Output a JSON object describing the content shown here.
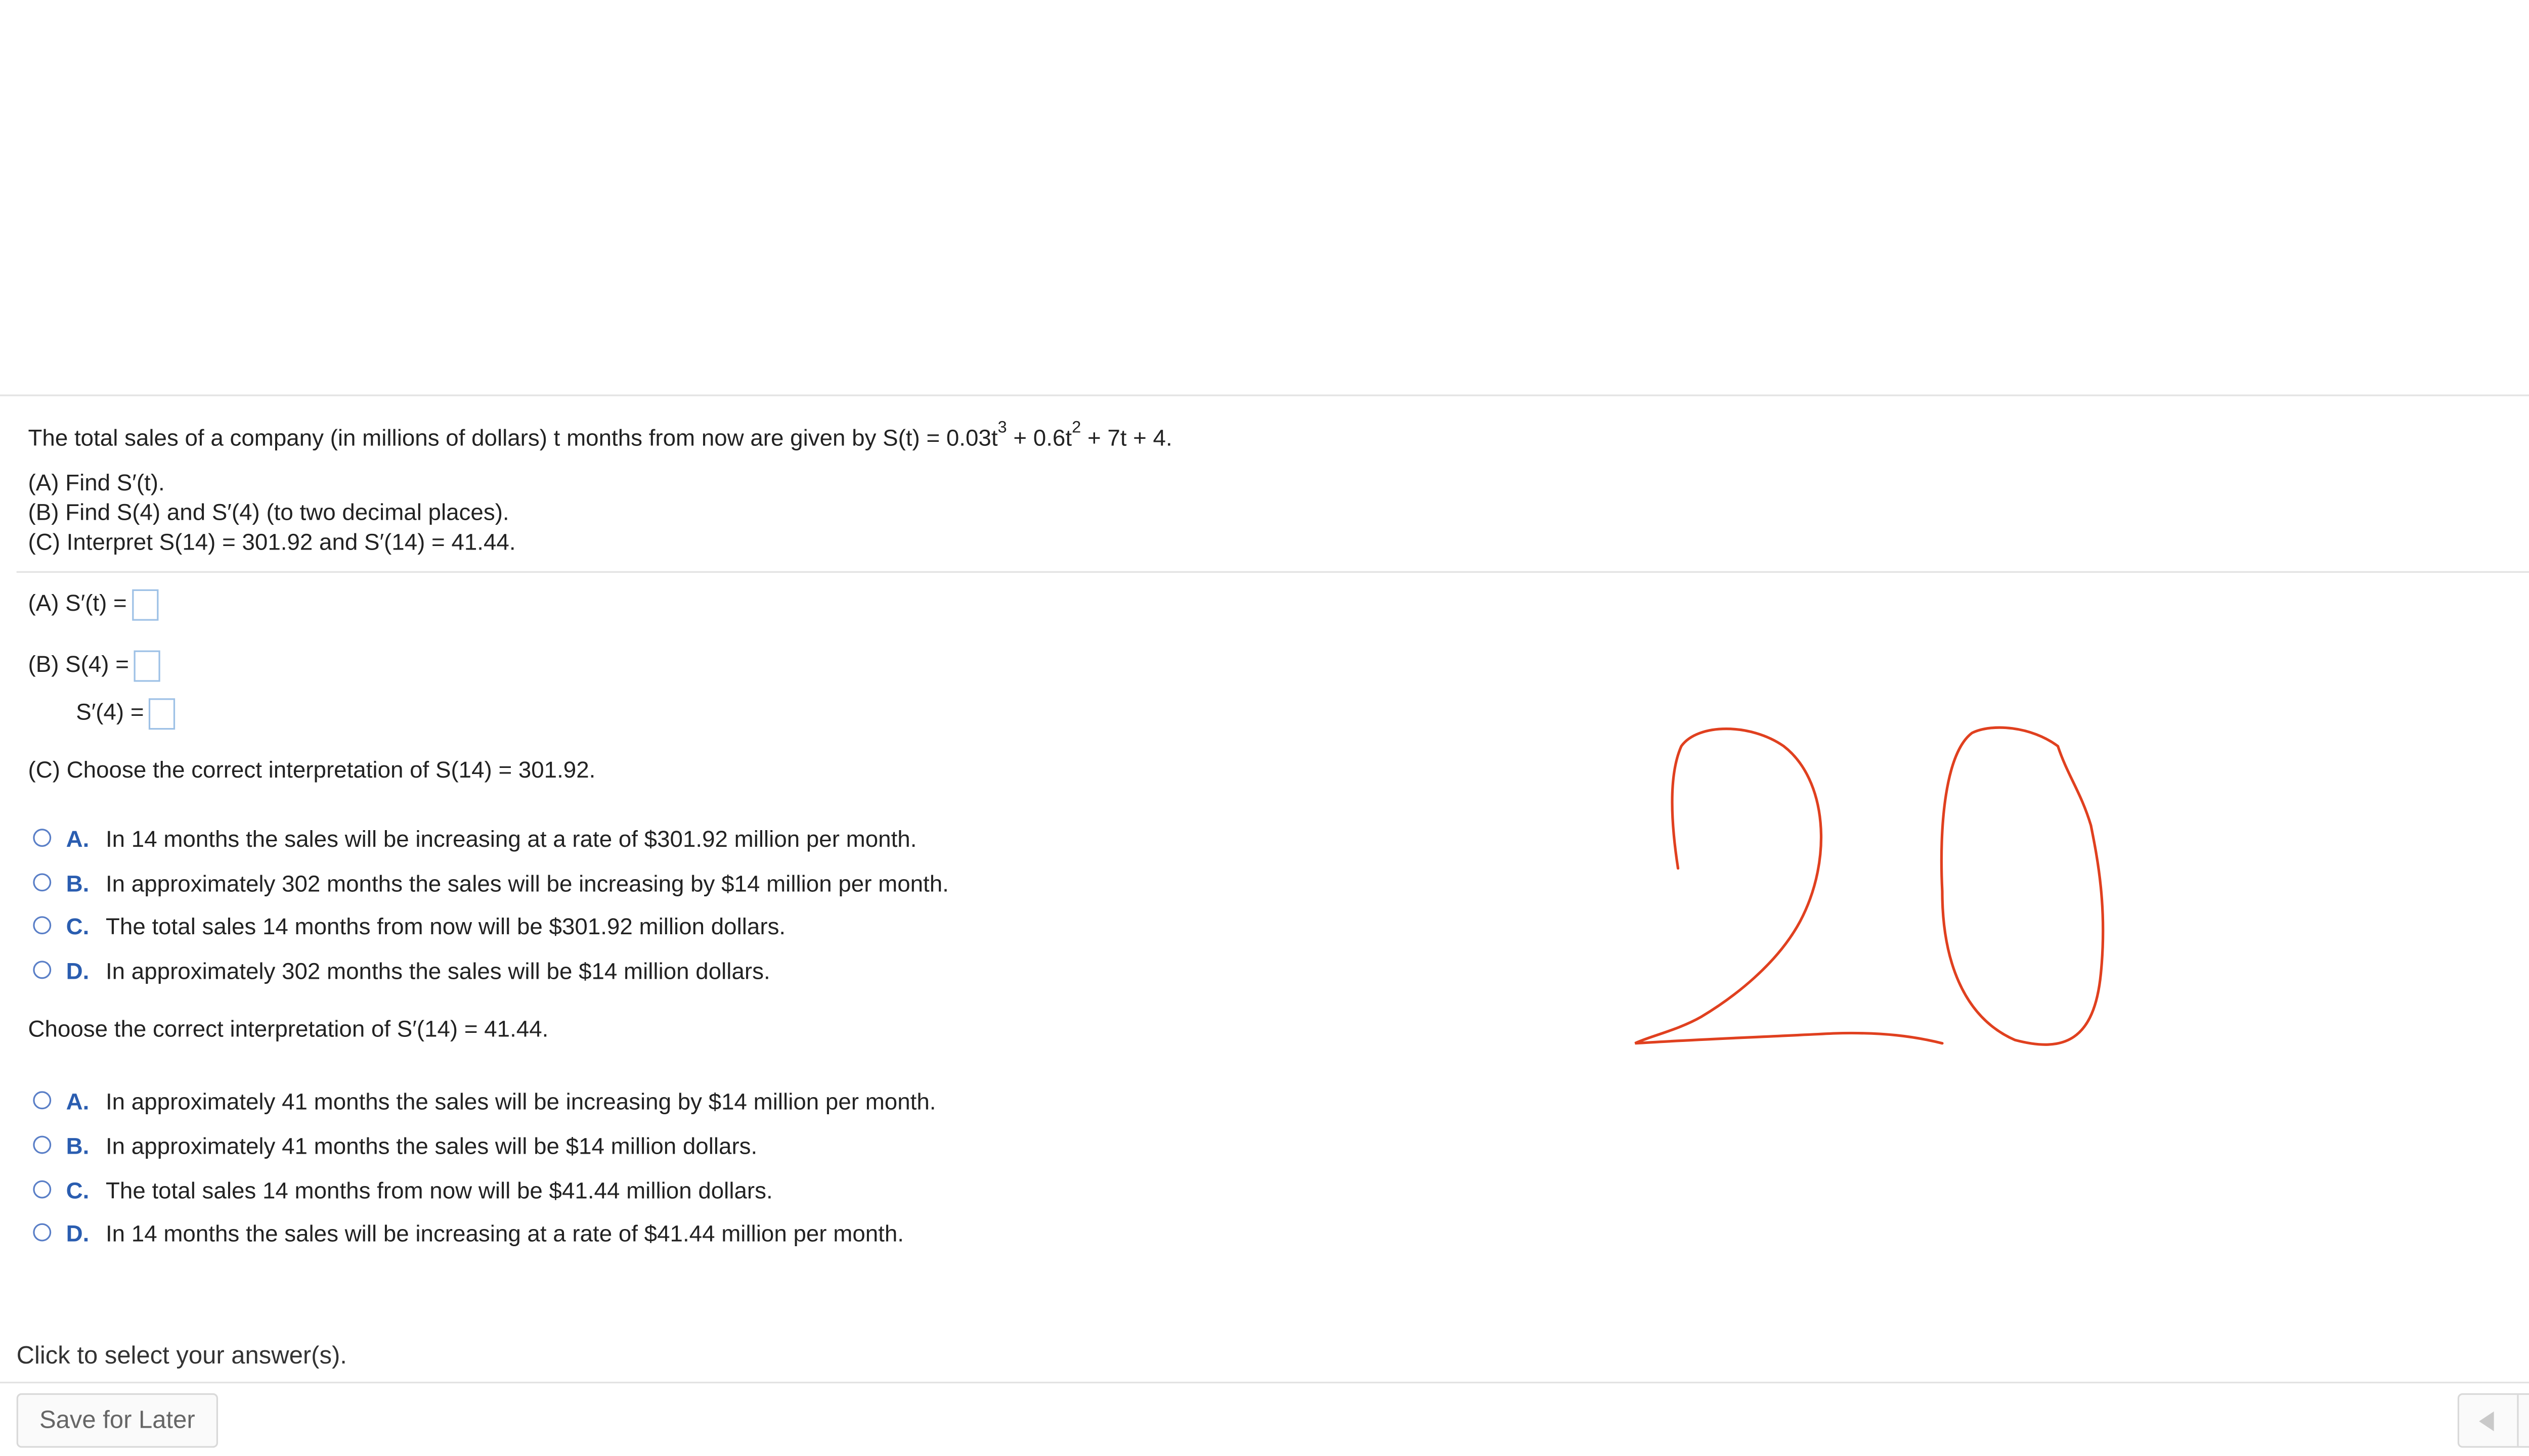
{
  "question": {
    "stem_prefix": "The total sales of a company (in millions of dollars) t months from now are given by S(t) = 0.03t",
    "stem_exp1": "3",
    "stem_mid": " + 0.6t",
    "stem_exp2": "2",
    "stem_suffix": " + 7t + 4.",
    "parts": [
      "(A) Find S′(t).",
      "(B) Find S(4) and S′(4) (to two decimal places).",
      "(C) Interpret S(14) = 301.92 and S′(14) = 41.44."
    ]
  },
  "answers": {
    "a_label": "(A)  S′(t) =",
    "b_label": "(B)  S(4) =",
    "b2_label": "S′(4) =",
    "c_prompt": "(C)  Choose the correct interpretation of S(14) = 301.92.",
    "c_options": [
      {
        "letter": "A.",
        "text": "In 14 months the sales will be increasing at a rate of $301.92 million per month."
      },
      {
        "letter": "B.",
        "text": "In approximately 302 months the sales will be increasing by $14 million per month."
      },
      {
        "letter": "C.",
        "text": "The total sales 14 months from now will be $301.92 million dollars."
      },
      {
        "letter": "D.",
        "text": "In approximately 302 months the sales will be $14 million dollars."
      }
    ],
    "d_prompt": "Choose the correct interpretation of S′(14) = 41.44.",
    "d_options": [
      {
        "letter": "A.",
        "text": "In approximately 41 months the sales will be increasing by $14 million per month."
      },
      {
        "letter": "B.",
        "text": "In approximately 41 months the sales will be $14 million dollars."
      },
      {
        "letter": "C.",
        "text": "The total sales 14 months from now will be $41.44 million dollars."
      },
      {
        "letter": "D.",
        "text": "In 14 months the sales will be increasing at a rate of $41.44 million per month."
      }
    ]
  },
  "handwriting": {
    "text": "20",
    "color": "#e0401f"
  },
  "footer": {
    "status": "Click to select your answer(s).",
    "save_label": "Save for Later",
    "help_glyph": "?"
  },
  "icons": {
    "settings": "gear-icon",
    "help": "help-icon",
    "prev": "prev-arrow-icon",
    "next": "next-arrow-icon"
  },
  "colors": {
    "accent": "#2a5db0",
    "help_bg": "#f1c232",
    "ink": "#e0401f"
  }
}
